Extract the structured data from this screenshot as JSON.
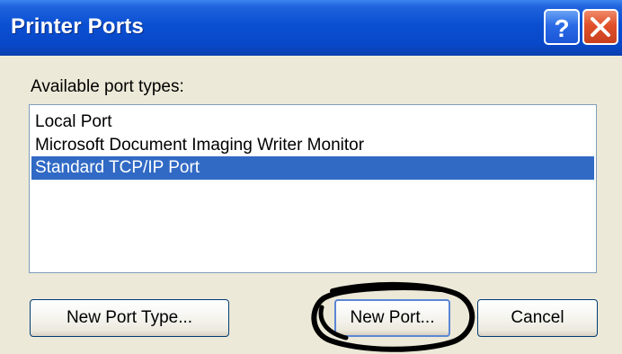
{
  "window": {
    "title": "Printer Ports",
    "help_icon": "help-icon",
    "close_icon": "close-icon",
    "help_glyph": "?"
  },
  "list": {
    "label": "Available port types:",
    "items": [
      {
        "label": "Local Port",
        "selected": false
      },
      {
        "label": "Microsoft Document Imaging Writer Monitor",
        "selected": false
      },
      {
        "label": "Standard TCP/IP Port",
        "selected": true
      }
    ]
  },
  "buttons": {
    "new_port_type": "New Port Type...",
    "new_port": "New Port...",
    "cancel": "Cancel"
  },
  "colors": {
    "titlebar": "#0a4fd2",
    "selection": "#316ac5",
    "dialog_bg": "#ece9d8",
    "annotation": "#000000"
  }
}
